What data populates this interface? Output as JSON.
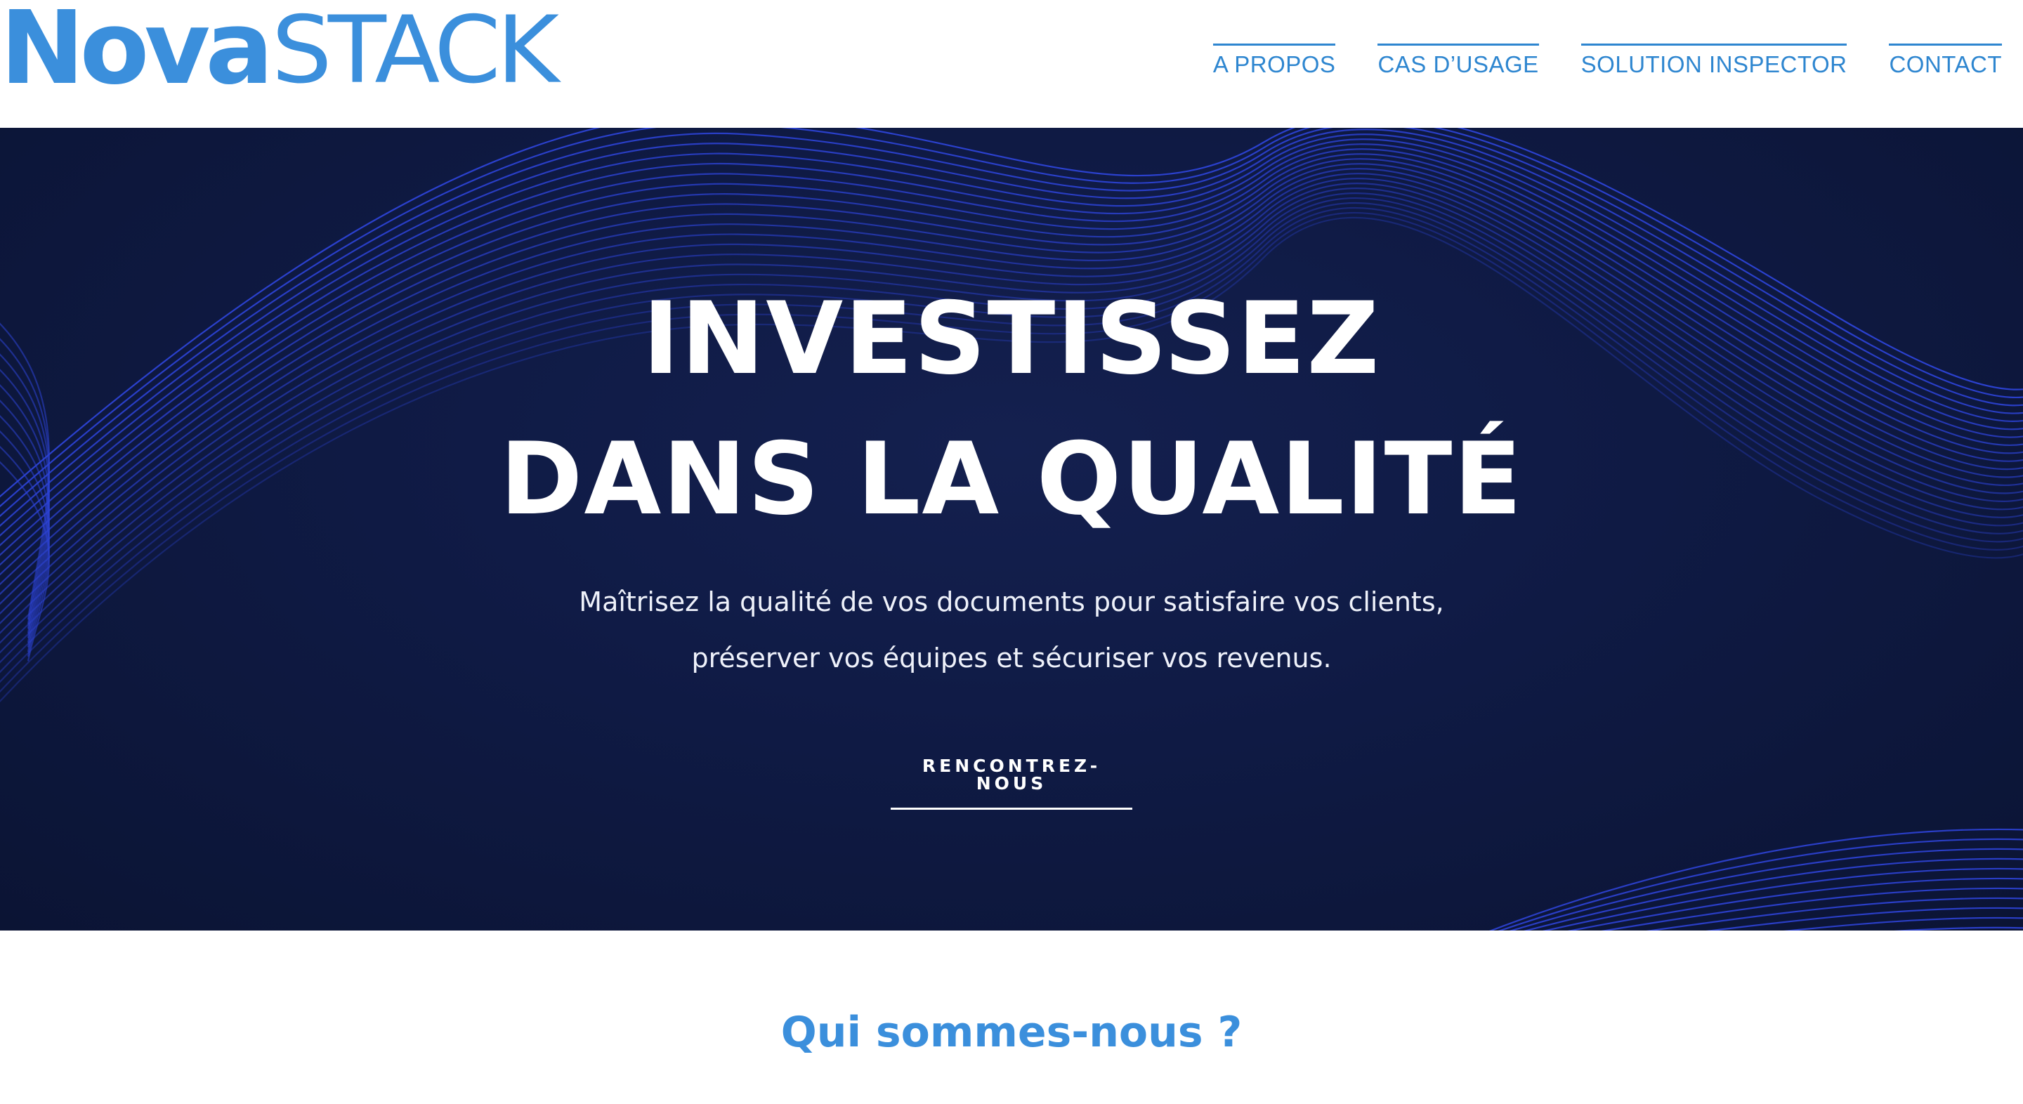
{
  "brand": {
    "logo_part1": "Nova",
    "logo_part2": "STACK",
    "color": "#3b8fdc"
  },
  "nav": {
    "items": [
      {
        "label": "A PROPOS"
      },
      {
        "label": "CAS D’USAGE"
      },
      {
        "label": "SOLUTION INSPECTOR"
      },
      {
        "label": "CONTACT"
      }
    ]
  },
  "hero": {
    "title_line1": "INVESTISSEZ",
    "title_line2": "DANS LA QUALITÉ",
    "subtitle_line1": "Maîtrisez la qualité de vos documents pour satisfaire vos clients,",
    "subtitle_line2": "préserver vos équipes et sécuriser vos revenus.",
    "cta_label": "RENCONTREZ-NOUS",
    "background_color": "#0f1a44",
    "wave_color": "#2d43d6"
  },
  "section": {
    "title": "Qui sommes-nous ?"
  }
}
